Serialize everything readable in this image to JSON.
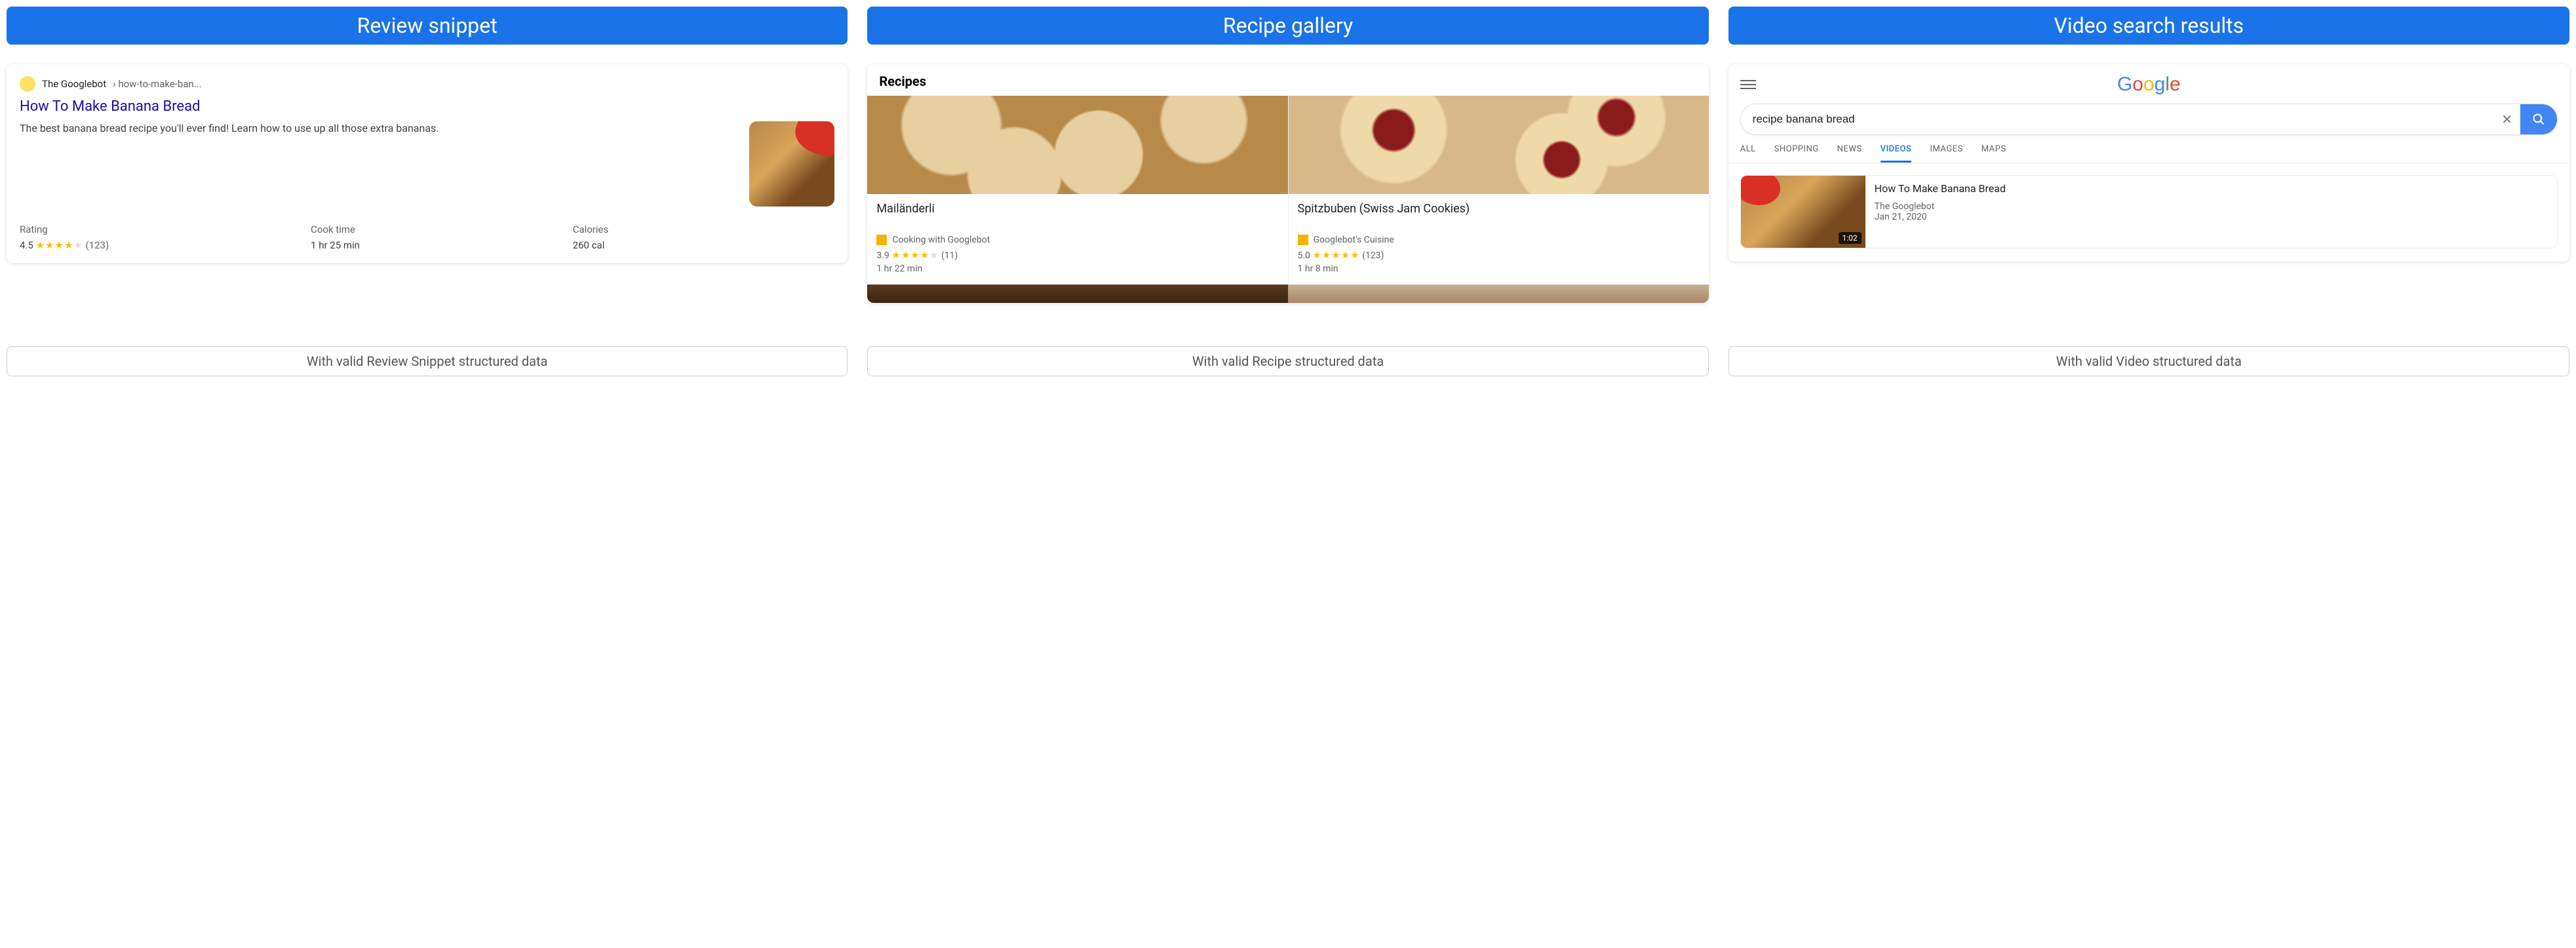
{
  "columns": {
    "review": {
      "header": "Review snippet",
      "site": "The Googlebot",
      "breadcrumb": "› how-to-make-ban...",
      "title": "How To Make Banana Bread",
      "description": "The best banana bread recipe you'll ever find! Learn how to use up all those extra bananas.",
      "stats": {
        "rating_label": "Rating",
        "rating_value": "4.5",
        "rating_count": "(123)",
        "cook_label": "Cook time",
        "cook_value": "1 hr 25 min",
        "cal_label": "Calories",
        "cal_value": "260 cal"
      },
      "caption": "With valid Review Snippet structured data"
    },
    "recipe": {
      "header": "Recipe gallery",
      "section_title": "Recipes",
      "items": [
        {
          "title": "Mailänderli",
          "source": "Cooking with Googlebot",
          "rating": "3.9",
          "count": "(11)",
          "time": "1 hr 22 min",
          "stars_full": 4,
          "stars_empty": 1
        },
        {
          "title": "Spitzbuben (Swiss Jam Cookies)",
          "source": "Googlebot's Cuisine",
          "rating": "5.0",
          "count": "(123)",
          "time": "1 hr 8 min",
          "stars_full": 5,
          "stars_empty": 0
        }
      ],
      "caption": "With valid Recipe structured data"
    },
    "video": {
      "header": "Video search results",
      "logo_text": "Google",
      "search": {
        "query": "recipe banana bread",
        "placeholder": ""
      },
      "tabs": [
        "ALL",
        "SHOPPING",
        "NEWS",
        "VIDEOS",
        "IMAGES",
        "MAPS"
      ],
      "active_tab": "VIDEOS",
      "result": {
        "title": "How To Make Banana Bread",
        "source": "The Googlebot",
        "date": "Jan 21, 2020",
        "duration": "1:02"
      },
      "caption": "With valid Video structured data"
    }
  }
}
